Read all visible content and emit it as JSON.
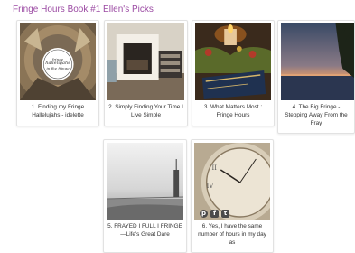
{
  "header": {
    "title": "Fringe Hours Book #1 Ellen's Picks"
  },
  "cards": [
    {
      "caption": "1. Finding my Fringe Hallelujahs - idelette",
      "badge_line1": "fringe",
      "badge_line2": "hallelujahs",
      "badge_line3": "in the fringe"
    },
    {
      "caption": "2. Simply Finding Your Time I Live Simple"
    },
    {
      "caption": "3. What Matters Most : Fringe Hours"
    },
    {
      "caption": "4. The Big Fringe - Stepping Away From the Fray"
    },
    {
      "caption": "5. FRAYED I FULL I FRINGE—Life's Great Dare"
    },
    {
      "caption": "6. Yes, I have the same number of hours in my day as"
    }
  ],
  "social": {
    "pinterest_icon": "pinterest-icon",
    "facebook_icon": "facebook-icon",
    "twitter_icon": "twitter-icon",
    "pinterest_glyph": "p",
    "facebook_glyph": "f",
    "twitter_glyph": "t"
  },
  "colors": {
    "title": "#9b4aa3",
    "caption_text": "#333333",
    "card_border": "#e2e2e2"
  }
}
